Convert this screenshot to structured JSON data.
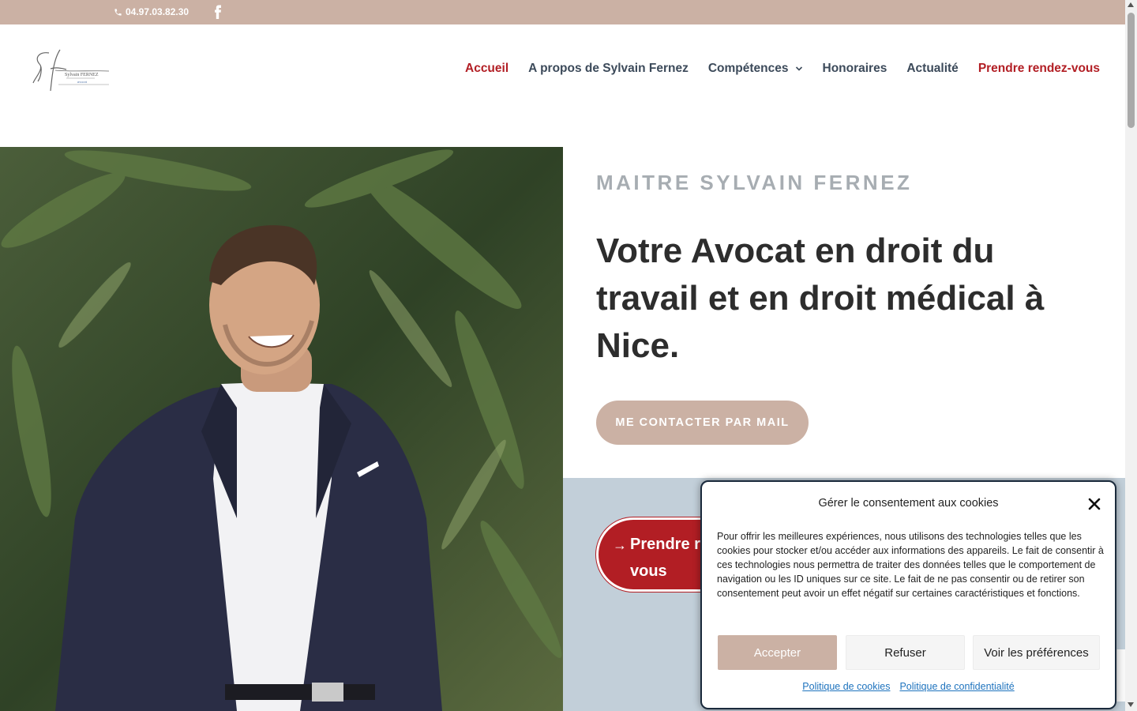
{
  "topbar": {
    "phone": "04.97.03.82.30",
    "social_icon": "facebook-icon"
  },
  "header": {
    "logo_alt": "Sylvain FERNEZ avocat",
    "logo_text": "Sylvain FERNEZ",
    "logo_sub": "avocat",
    "nav": [
      {
        "label": "Accueil",
        "active": true
      },
      {
        "label": "A propos de Sylvain Fernez"
      },
      {
        "label": "Compétences",
        "dropdown": true
      },
      {
        "label": "Honoraires"
      },
      {
        "label": "Actualité"
      },
      {
        "label": "Prendre rendez-vous",
        "highlight": true
      }
    ]
  },
  "hero": {
    "eyebrow": "MAITRE SYLVAIN FERNEZ",
    "headline": "Votre Avocat en droit du travail et en droit médical à Nice.",
    "contact_button": "ME CONTACTER PAR MAIL",
    "appointment_button": "Prendre rendez-vous",
    "appointment_visible_line1": "Prendre r",
    "appointment_visible_line2": "vous"
  },
  "cookie_modal": {
    "title": "Gérer le consentement aux cookies",
    "body": "Pour offrir les meilleures expériences, nous utilisons des technologies telles que les cookies pour stocker et/ou accéder aux informations des appareils. Le fait de consentir à ces technologies nous permettra de traiter des données telles que le comportement de navigation ou les ID uniques sur ce site. Le fait de ne pas consentir ou de retirer son consentement peut avoir un effet négatif sur certaines caractéristiques et fonctions.",
    "accept": "Accepter",
    "refuse": "Refuser",
    "preferences": "Voir les préférences",
    "cookie_policy": "Politique de cookies",
    "privacy_policy": "Politique de confidentialité"
  },
  "colors": {
    "accent_tan": "#cbb1a4",
    "brand_red": "#b21e24",
    "nav_text": "#3c4a5a",
    "band_blue": "#c2cfd9"
  }
}
